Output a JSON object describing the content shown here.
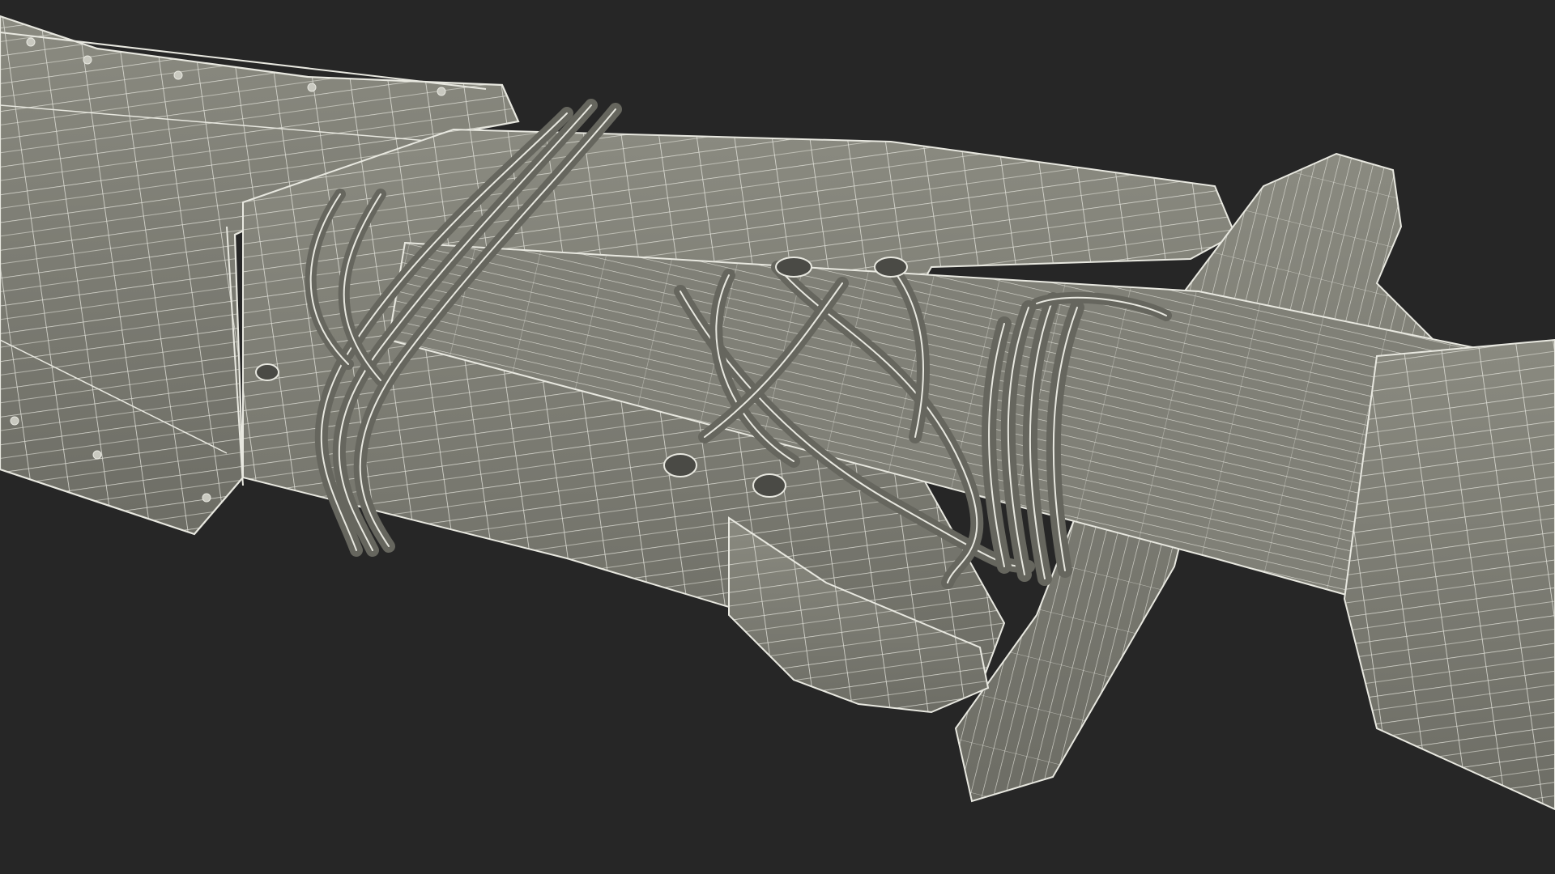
{
  "scene": {
    "subject": "wireframe-render",
    "background_color": "#262626",
    "surface_color": "#7b7b72",
    "surface_shadow_color": "#5f5f58",
    "wire_color": "#e8e8e0",
    "cord_color": "#6c6c64"
  }
}
